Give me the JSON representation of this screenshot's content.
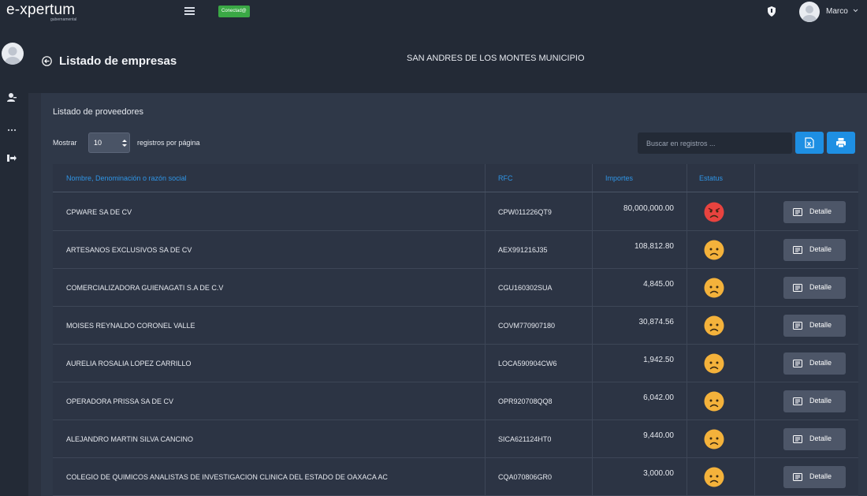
{
  "brand": {
    "name": "e-xpertum",
    "subtitle": "gubernamental"
  },
  "header": {
    "status_badge": "Conectad@",
    "user_name": "Marco"
  },
  "page": {
    "title": "Listado de empresas",
    "municipality": "SAN ANDRES DE LOS MONTES MUNICIPIO"
  },
  "panel": {
    "title": "Listado de proveedores",
    "show_label": "Mostrar",
    "page_size": "10",
    "per_page_label": "registros por página",
    "search_placeholder": "Buscar en registros ..."
  },
  "table": {
    "columns": [
      "Nombre, Denominación o razón social",
      "RFC",
      "Importes",
      "Estatus"
    ],
    "detail_label": "Detalle",
    "rows": [
      {
        "name": "CPWARE SA DE CV",
        "rfc": "CPW011226QT9",
        "amount": "80,000,000.00",
        "status": "angry"
      },
      {
        "name": "ARTESANOS EXCLUSIVOS SA DE CV",
        "rfc": "AEX991216J35",
        "amount": "108,812.80",
        "status": "sad"
      },
      {
        "name": "COMERCIALIZADORA GUIENAGATI S.A DE C.V",
        "rfc": "CGU160302SUA",
        "amount": "4,845.00",
        "status": "sad"
      },
      {
        "name": "MOISES REYNALDO CORONEL VALLE",
        "rfc": "COVM770907180",
        "amount": "30,874.56",
        "status": "sad"
      },
      {
        "name": "AURELIA ROSALIA LOPEZ CARRILLO",
        "rfc": "LOCA590904CW6",
        "amount": "1,942.50",
        "status": "sad"
      },
      {
        "name": "OPERADORA PRISSA SA DE CV",
        "rfc": "OPR920708QQ8",
        "amount": "6,042.00",
        "status": "sad"
      },
      {
        "name": "ALEJANDRO MARTIN SILVA CANCINO",
        "rfc": "SICA621124HT0",
        "amount": "9,440.00",
        "status": "sad"
      },
      {
        "name": "COLEGIO DE QUIMICOS ANALISTAS DE INVESTIGACION CLINICA DEL ESTADO DE OAXACA AC",
        "rfc": "CQA070806GR0",
        "amount": "3,000.00",
        "status": "sad"
      }
    ]
  },
  "colors": {
    "accent": "#1e8fe3",
    "angry": "#e8433f",
    "sad": "#f4b23b",
    "connected": "#3aa845"
  }
}
